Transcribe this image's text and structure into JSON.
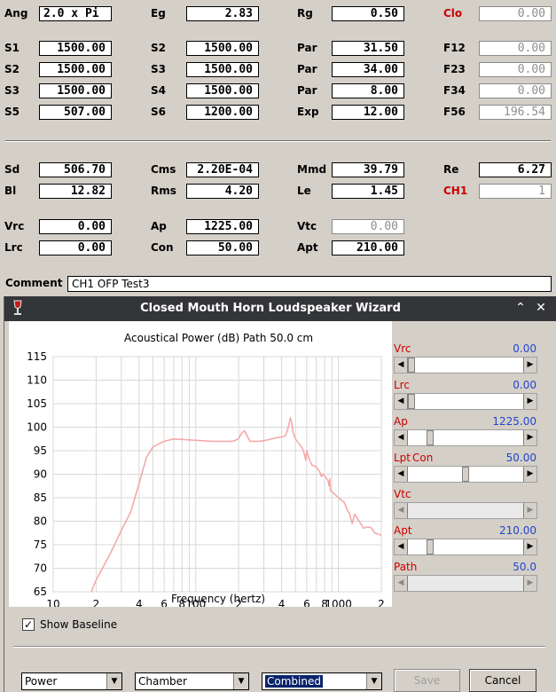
{
  "params": {
    "ang": {
      "label": "Ang",
      "value": "2.0 x Pi"
    },
    "eg": {
      "label": "Eg",
      "value": "2.83"
    },
    "rg": {
      "label": "Rg",
      "value": "0.50"
    },
    "clo": {
      "label": "Clo",
      "value": "0.00"
    },
    "s1": {
      "label": "S1",
      "value": "1500.00"
    },
    "s2a": {
      "label": "S2",
      "value": "1500.00"
    },
    "par1": {
      "label": "Par",
      "value": "31.50"
    },
    "f12": {
      "label": "F12",
      "value": "0.00"
    },
    "s2b": {
      "label": "S2",
      "value": "1500.00"
    },
    "s3a": {
      "label": "S3",
      "value": "1500.00"
    },
    "par2": {
      "label": "Par",
      "value": "34.00"
    },
    "f23": {
      "label": "F23",
      "value": "0.00"
    },
    "s3b": {
      "label": "S3",
      "value": "1500.00"
    },
    "s4": {
      "label": "S4",
      "value": "1500.00"
    },
    "par3": {
      "label": "Par",
      "value": "8.00"
    },
    "f34": {
      "label": "F34",
      "value": "0.00"
    },
    "s5": {
      "label": "S5",
      "value": "507.00"
    },
    "s6": {
      "label": "S6",
      "value": "1200.00"
    },
    "exp": {
      "label": "Exp",
      "value": "12.00"
    },
    "f56": {
      "label": "F56",
      "value": "196.54"
    },
    "sd": {
      "label": "Sd",
      "value": "506.70"
    },
    "cms": {
      "label": "Cms",
      "value": "2.20E-04"
    },
    "mmd": {
      "label": "Mmd",
      "value": "39.79"
    },
    "re": {
      "label": "Re",
      "value": "6.27"
    },
    "bl": {
      "label": "Bl",
      "value": "12.82"
    },
    "rms": {
      "label": "Rms",
      "value": "4.20"
    },
    "le": {
      "label": "Le",
      "value": "1.45"
    },
    "ch1": {
      "label": "CH1",
      "value": "1"
    },
    "vrc": {
      "label": "Vrc",
      "value": "0.00"
    },
    "ap": {
      "label": "Ap",
      "value": "1225.00"
    },
    "vtc": {
      "label": "Vtc",
      "value": "0.00"
    },
    "lrc": {
      "label": "Lrc",
      "value": "0.00"
    },
    "con": {
      "label": "Con",
      "value": "50.00"
    },
    "apt": {
      "label": "Apt",
      "value": "210.00"
    }
  },
  "comment": {
    "label": "Comment",
    "value": "CH1 OFP Test3"
  },
  "wizard": {
    "title": "Closed Mouth Horn Loudspeaker Wizard",
    "show_baseline_label": "Show Baseline",
    "show_baseline_checked": true,
    "selects": [
      "Power",
      "Chamber",
      "Combined"
    ],
    "save_label": "Save",
    "cancel_label": "Cancel",
    "sliders": [
      {
        "label": "Vrc",
        "value": "0.00",
        "position": 0.0,
        "enabled": true
      },
      {
        "label": "Lrc",
        "value": "0.00",
        "position": 0.0,
        "enabled": true
      },
      {
        "label": "Ap",
        "value": "1225.00",
        "position": 0.17,
        "enabled": true
      },
      {
        "label": "Lpt",
        "label2": "Con",
        "value": "50.00",
        "position": 0.5,
        "enabled": true
      },
      {
        "label": "Vtc",
        "value": "",
        "position": 0.0,
        "enabled": false
      },
      {
        "label": "Apt",
        "value": "210.00",
        "position": 0.17,
        "enabled": true
      },
      {
        "label": "Path",
        "value": "50.0",
        "position": 0.0,
        "enabled": false
      }
    ]
  },
  "chart_data": {
    "type": "line",
    "title": "Acoustical Power (dB)  Path 50.0 cm",
    "xlabel": "Frequency (hertz)",
    "ylabel": "",
    "x_scale": "log",
    "xlim": [
      10,
      2000
    ],
    "ylim": [
      65,
      115
    ],
    "yticks": [
      115,
      110,
      105,
      100,
      95,
      90,
      85,
      80,
      75,
      70,
      65
    ],
    "xticks": [
      {
        "v": 10,
        "label": "10"
      },
      {
        "v": 20,
        "label": "2"
      },
      {
        "v": 40,
        "label": "4"
      },
      {
        "v": 60,
        "label": "6"
      },
      {
        "v": 80,
        "label": "8"
      },
      {
        "v": 100,
        "label": "100"
      },
      {
        "v": 200,
        "label": "2"
      },
      {
        "v": 400,
        "label": "4"
      },
      {
        "v": 600,
        "label": "6"
      },
      {
        "v": 800,
        "label": "8"
      },
      {
        "v": 1000,
        "label": "1000"
      },
      {
        "v": 2000,
        "label": "2"
      }
    ],
    "color": "#f4aaaa",
    "series": [
      {
        "x": [
          18.5,
          20,
          25,
          30,
          35,
          40,
          45,
          50,
          60,
          70,
          80,
          100,
          130,
          160,
          180,
          190,
          200,
          205,
          210,
          220,
          240,
          280,
          320,
          360,
          400,
          420,
          430,
          440,
          450,
          460,
          470,
          480,
          500,
          560,
          580,
          590,
          600,
          620,
          650,
          700,
          740,
          760,
          780,
          800,
          850,
          860,
          870,
          880,
          900,
          1000,
          1100,
          1150,
          1200,
          1250,
          1300,
          1400,
          1500,
          1600,
          1700,
          1800,
          1900,
          2000
        ],
        "y": [
          65,
          67.5,
          73,
          78,
          82,
          88,
          93.5,
          95.8,
          97,
          97.5,
          97.4,
          97.2,
          97,
          97,
          97,
          97.2,
          97.6,
          98.2,
          98.8,
          99.2,
          97,
          97,
          97.3,
          97.7,
          97.9,
          98.1,
          98.5,
          99.5,
          100.5,
          102,
          101,
          99,
          97.5,
          95.5,
          94,
          93,
          95,
          93.5,
          92,
          91.5,
          90.5,
          89.5,
          90,
          89.7,
          88.5,
          87.5,
          89,
          86.5,
          86.3,
          85,
          84,
          82.5,
          81.5,
          79.5,
          81.5,
          80,
          78.5,
          78.8,
          78.6,
          77.5,
          77.3,
          77
        ]
      }
    ]
  }
}
